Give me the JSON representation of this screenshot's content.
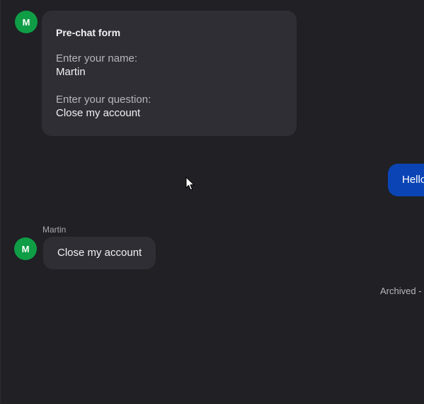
{
  "conversation": {
    "prechat": {
      "avatar_initial": "M",
      "title": "Pre-chat form",
      "fields": [
        {
          "label": "Enter your name:",
          "value": "Martin"
        },
        {
          "label": "Enter your question:",
          "value": "Close my account"
        }
      ]
    },
    "outgoing": {
      "text": "Hello"
    },
    "incoming": {
      "sender": "Martin",
      "avatar_initial": "M",
      "text": "Close my account"
    },
    "status": {
      "archived_text": "Archived -"
    }
  },
  "colors": {
    "background": "#202025",
    "card": "#2e2e34",
    "avatar": "#0f9d46",
    "outgoing_bubble": "#0b45b5"
  },
  "icons": {
    "cursor": "mouse-pointer-icon"
  }
}
